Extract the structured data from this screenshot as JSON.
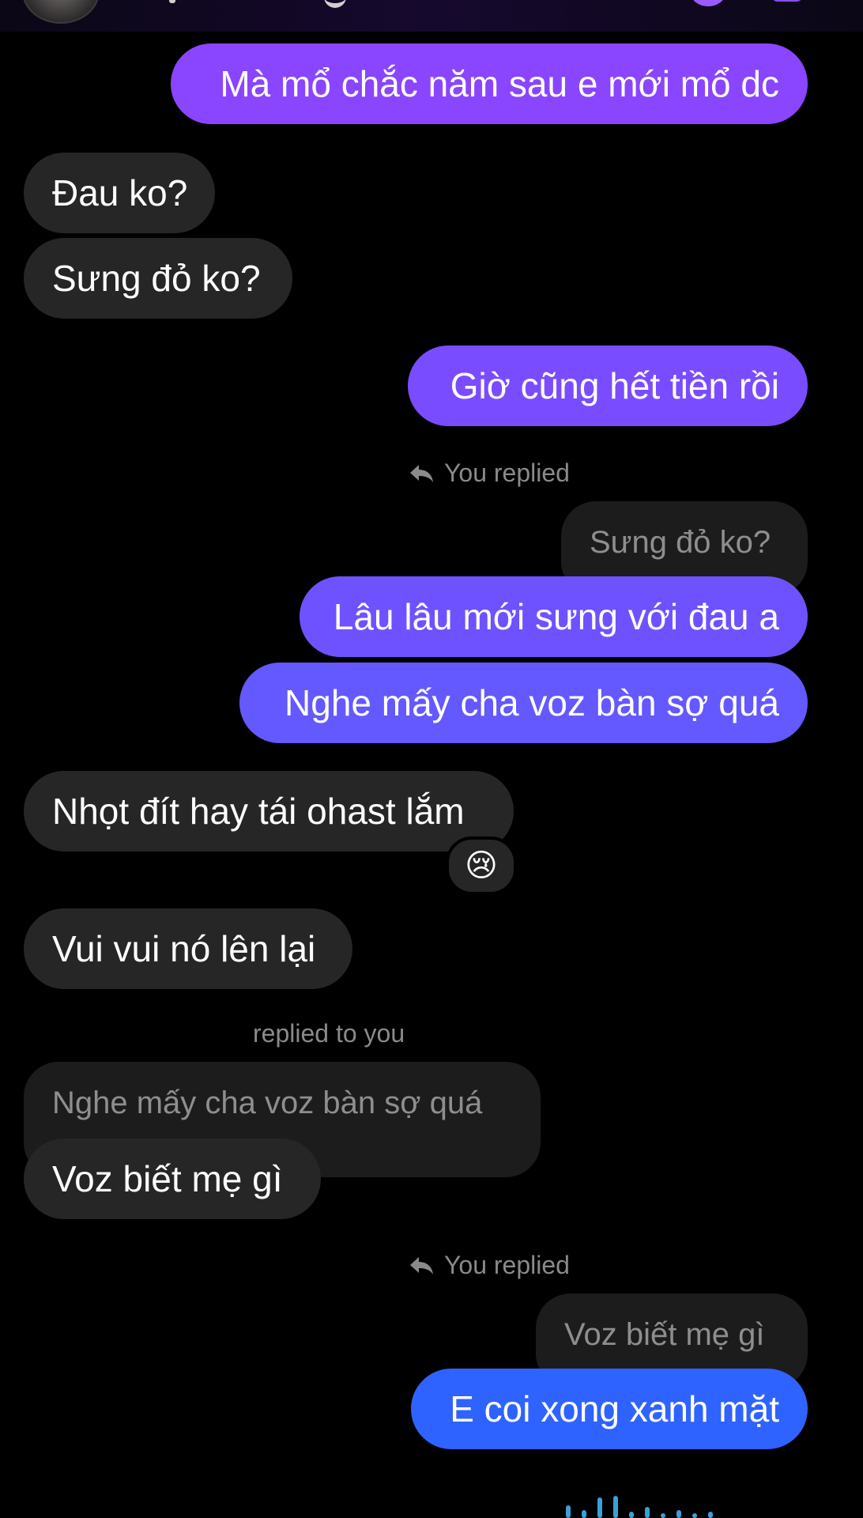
{
  "header": {
    "contact_name": "",
    "icons": [
      "avatar",
      "call-icon",
      "video-icon"
    ]
  },
  "messages": [
    {
      "id": "m1",
      "side": "mine",
      "text": "Mà mổ chắc năm sau e mới mổ dc",
      "color": "#8a45ff"
    },
    {
      "id": "m2",
      "side": "theirs",
      "text": "Đau ko?"
    },
    {
      "id": "m3",
      "side": "theirs",
      "text": "Sưng đỏ ko?"
    },
    {
      "id": "m4",
      "side": "mine",
      "text": "Giờ cũng hết tiền rồi",
      "color": "#7a4cff"
    },
    {
      "id": "m5",
      "side": "mine",
      "reply_label": "You replied",
      "quoted": "Sưng đỏ ko?",
      "text": "Lâu lâu mới sưng với đau a",
      "color": "#6e52ff"
    },
    {
      "id": "m6",
      "side": "mine",
      "text": "Nghe mấy cha voz bàn sợ quá",
      "color": "#6458ff"
    },
    {
      "id": "m7",
      "side": "theirs",
      "text": "Nhọt đít hay tái ohast lắm",
      "reaction": "😢"
    },
    {
      "id": "m8",
      "side": "theirs",
      "text": "Vui vui nó lên lại"
    },
    {
      "id": "m9",
      "side": "theirs",
      "reply_label": "replied to you",
      "quoted": "Nghe mấy cha voz bàn sợ quá",
      "text": "Voz biết mẹ gì"
    },
    {
      "id": "m10",
      "side": "mine",
      "reply_label": "You replied",
      "quoted": "Voz biết mẹ gì",
      "text": "E coi xong xanh mặt",
      "color": "#2f63ff"
    }
  ],
  "colors": {
    "background": "#000000",
    "incoming_bubble": "#262626",
    "quote_bubble": "#1c1c1c",
    "muted_text": "#8e8e8e",
    "voice_wave": "#3c9fd8"
  }
}
